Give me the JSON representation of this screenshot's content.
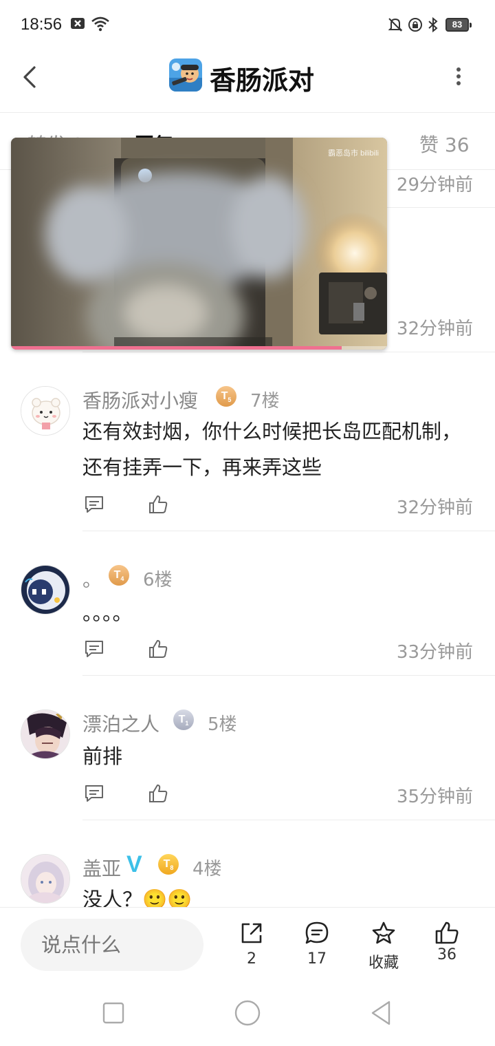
{
  "status": {
    "time": "18:56",
    "battery": "83"
  },
  "header": {
    "title": "香肠派对"
  },
  "tabs": [
    {
      "label": "转发 2"
    },
    {
      "label": "回复 17"
    },
    {
      "label": "赞 36"
    }
  ],
  "video": {
    "watermark": "霸恶岛市 bilibili",
    "progress": 0.88
  },
  "previous": {
    "time1": "29分钟前",
    "time2": "32分钟前"
  },
  "comments": [
    {
      "name": "香肠派对小瘦",
      "level": "5",
      "floor": "7楼",
      "text": "还有效封烟，你什么时候把长岛匹配机制，还有挂弄一下，再来弄这些",
      "time": "32分钟前"
    },
    {
      "name": "。",
      "level": "4",
      "floor": "6楼",
      "text": "。。。。",
      "time": "33分钟前"
    },
    {
      "name": "漂泊之人",
      "level": "1",
      "floor": "5楼",
      "text": "前排",
      "time": "35分钟前"
    },
    {
      "name": "盖亚",
      "level": "8",
      "floor": "4楼",
      "text": "没人？🙂🙂",
      "time": "",
      "verified": "V"
    }
  ],
  "bottom": {
    "placeholder": "说点什么",
    "share_count": "2",
    "reply_count": "17",
    "favorite_label": "收藏",
    "like_count": "36"
  }
}
